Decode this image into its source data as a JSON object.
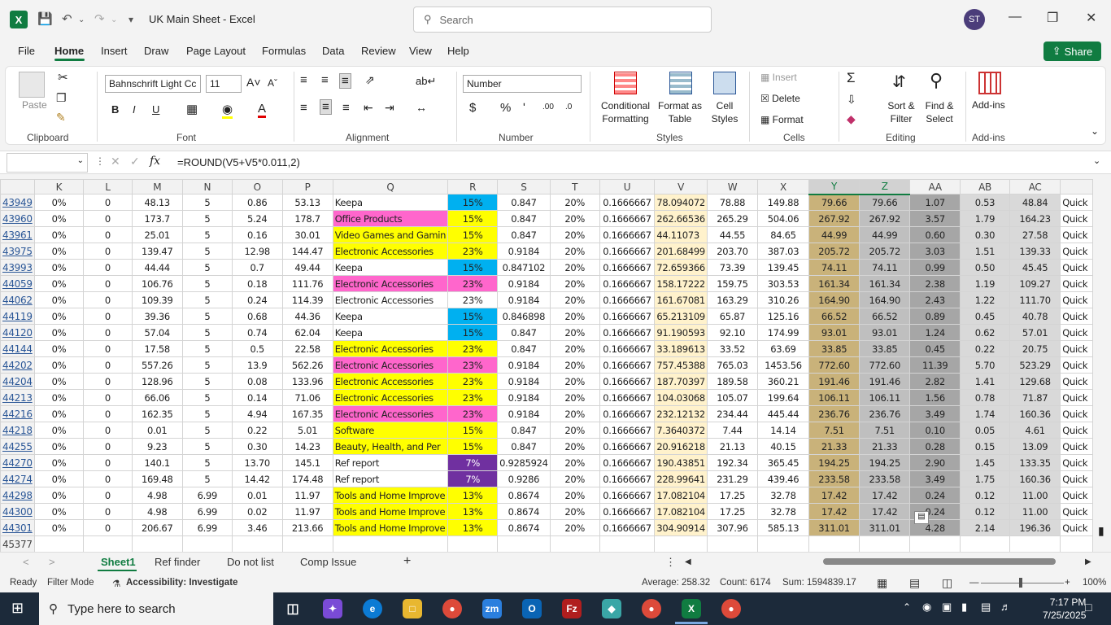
{
  "window": {
    "title": "UK Main Sheet  -  Excel",
    "user_initials": "ST"
  },
  "search": {
    "placeholder": "Search"
  },
  "menu": [
    "File",
    "Home",
    "Insert",
    "Draw",
    "Page Layout",
    "Formulas",
    "Data",
    "Review",
    "View",
    "Help"
  ],
  "share_label": "Share",
  "ribbon": {
    "clipboard": {
      "label": "Clipboard",
      "paste": "Paste"
    },
    "font": {
      "label": "Font",
      "name": "Bahnschrift Light Cc",
      "size": "11",
      "bold": "B",
      "italic": "I",
      "underline": "U"
    },
    "alignment": {
      "label": "Alignment"
    },
    "number": {
      "label": "Number",
      "format": "Number"
    },
    "styles": {
      "label": "Styles",
      "conditional": "Conditional Formatting",
      "format_table": "Format as Table",
      "cell_styles": "Cell Styles"
    },
    "cells": {
      "label": "Cells",
      "insert": "Insert",
      "delete": "Delete",
      "format": "Format"
    },
    "editing": {
      "label": "Editing",
      "sort": "Sort & Filter",
      "find": "Find & Select"
    },
    "addins": {
      "label": "Add-ins",
      "addins": "Add-ins"
    }
  },
  "formula_bar": {
    "formula": "=ROUND(V5+V5*0.011,2)",
    "fx": "fx"
  },
  "columns": [
    "K",
    "L",
    "M",
    "N",
    "O",
    "P",
    "Q",
    "R",
    "S",
    "T",
    "U",
    "V",
    "W",
    "X",
    "Y",
    "Z",
    "AA",
    "AB",
    "AC",
    ""
  ],
  "selected_columns": [
    "Y",
    "Z"
  ],
  "colors": {
    "pink": "#ff66cc",
    "yellow": "#ffff00",
    "cyan": "#00b0f0",
    "purple": "#7030a0",
    "tan": "#fff2cc",
    "yz": "#c9b27a",
    "yz2": "#bfbfbf",
    "aa": "#a6a6a6",
    "excel_green": "#107c41"
  },
  "rows": [
    {
      "r": "43949",
      "k": "0%",
      "l": "0",
      "m": "48.13",
      "n": "5",
      "o": "0.86",
      "p": "53.13",
      "q": "Keepa",
      "qc": "",
      "rv": "15%",
      "rc": "cyan",
      "s": "0.847",
      "t": "20%",
      "u": "0.1666667",
      "v": "78.094072",
      "w": "78.88",
      "x": "149.88",
      "y": "79.66",
      "z": "79.66",
      "aa": "1.07",
      "ab": "0.53",
      "ac": "48.84",
      "ad": "Quick"
    },
    {
      "r": "43960",
      "k": "0%",
      "l": "0",
      "m": "173.7",
      "n": "5",
      "o": "5.24",
      "p": "178.7",
      "q": "Office Products",
      "qc": "pink",
      "rv": "15%",
      "rc": "yellow",
      "s": "0.847",
      "t": "20%",
      "u": "0.1666667",
      "v": "262.66536",
      "w": "265.29",
      "x": "504.06",
      "y": "267.92",
      "z": "267.92",
      "aa": "3.57",
      "ab": "1.79",
      "ac": "164.23",
      "ad": "Quick"
    },
    {
      "r": "43961",
      "k": "0%",
      "l": "0",
      "m": "25.01",
      "n": "5",
      "o": "0.16",
      "p": "30.01",
      "q": "Video Games and Gamin",
      "qc": "yellow",
      "rv": "15%",
      "rc": "yellow",
      "s": "0.847",
      "t": "20%",
      "u": "0.1666667",
      "v": "44.11073",
      "w": "44.55",
      "x": "84.65",
      "y": "44.99",
      "z": "44.99",
      "aa": "0.60",
      "ab": "0.30",
      "ac": "27.58",
      "ad": "Quick"
    },
    {
      "r": "43975",
      "k": "0%",
      "l": "0",
      "m": "139.47",
      "n": "5",
      "o": "12.98",
      "p": "144.47",
      "q": "Electronic Accessories",
      "qc": "yellow",
      "rv": "23%",
      "rc": "yellow",
      "s": "0.9184",
      "t": "20%",
      "u": "0.1666667",
      "v": "201.68499",
      "w": "203.70",
      "x": "387.03",
      "y": "205.72",
      "z": "205.72",
      "aa": "3.03",
      "ab": "1.51",
      "ac": "139.33",
      "ad": "Quick"
    },
    {
      "r": "43993",
      "k": "0%",
      "l": "0",
      "m": "44.44",
      "n": "5",
      "o": "0.7",
      "p": "49.44",
      "q": "Keepa",
      "qc": "",
      "rv": "15%",
      "rc": "cyan",
      "s": "0.847102",
      "t": "20%",
      "u": "0.1666667",
      "v": "72.659366",
      "w": "73.39",
      "x": "139.45",
      "y": "74.11",
      "z": "74.11",
      "aa": "0.99",
      "ab": "0.50",
      "ac": "45.45",
      "ad": "Quick"
    },
    {
      "r": "44059",
      "k": "0%",
      "l": "0",
      "m": "106.76",
      "n": "5",
      "o": "0.18",
      "p": "111.76",
      "q": "Electronic Accessories",
      "qc": "pink",
      "rv": "23%",
      "rc": "pink",
      "s": "0.9184",
      "t": "20%",
      "u": "0.1666667",
      "v": "158.17222",
      "w": "159.75",
      "x": "303.53",
      "y": "161.34",
      "z": "161.34",
      "aa": "2.38",
      "ab": "1.19",
      "ac": "109.27",
      "ad": "Quick"
    },
    {
      "r": "44062",
      "k": "0%",
      "l": "0",
      "m": "109.39",
      "n": "5",
      "o": "0.24",
      "p": "114.39",
      "q": "Electronic Accessories",
      "qc": "",
      "rv": "23%",
      "rc": "",
      "s": "0.9184",
      "t": "20%",
      "u": "0.1666667",
      "v": "161.67081",
      "w": "163.29",
      "x": "310.26",
      "y": "164.90",
      "z": "164.90",
      "aa": "2.43",
      "ab": "1.22",
      "ac": "111.70",
      "ad": "Quick"
    },
    {
      "r": "44119",
      "k": "0%",
      "l": "0",
      "m": "39.36",
      "n": "5",
      "o": "0.68",
      "p": "44.36",
      "q": "Keepa",
      "qc": "",
      "rv": "15%",
      "rc": "cyan",
      "s": "0.846898",
      "t": "20%",
      "u": "0.1666667",
      "v": "65.213109",
      "w": "65.87",
      "x": "125.16",
      "y": "66.52",
      "z": "66.52",
      "aa": "0.89",
      "ab": "0.45",
      "ac": "40.78",
      "ad": "Quick"
    },
    {
      "r": "44120",
      "k": "0%",
      "l": "0",
      "m": "57.04",
      "n": "5",
      "o": "0.74",
      "p": "62.04",
      "q": "Keepa",
      "qc": "",
      "rv": "15%",
      "rc": "cyan",
      "s": "0.847",
      "t": "20%",
      "u": "0.1666667",
      "v": "91.190593",
      "w": "92.10",
      "x": "174.99",
      "y": "93.01",
      "z": "93.01",
      "aa": "1.24",
      "ab": "0.62",
      "ac": "57.01",
      "ad": "Quick"
    },
    {
      "r": "44144",
      "k": "0%",
      "l": "0",
      "m": "17.58",
      "n": "5",
      "o": "0.5",
      "p": "22.58",
      "q": "Electronic Accessories",
      "qc": "yellow",
      "rv": "23%",
      "rc": "yellow",
      "s": "0.847",
      "t": "20%",
      "u": "0.1666667",
      "v": "33.189613",
      "w": "33.52",
      "x": "63.69",
      "y": "33.85",
      "z": "33.85",
      "aa": "0.45",
      "ab": "0.22",
      "ac": "20.75",
      "ad": "Quick"
    },
    {
      "r": "44202",
      "k": "0%",
      "l": "0",
      "m": "557.26",
      "n": "5",
      "o": "13.9",
      "p": "562.26",
      "q": "Electronic Accessories",
      "qc": "pink",
      "rv": "23%",
      "rc": "pink",
      "s": "0.9184",
      "t": "20%",
      "u": "0.1666667",
      "v": "757.45388",
      "w": "765.03",
      "x": "1453.56",
      "y": "772.60",
      "z": "772.60",
      "aa": "11.39",
      "ab": "5.70",
      "ac": "523.29",
      "ad": "Quick"
    },
    {
      "r": "44204",
      "k": "0%",
      "l": "0",
      "m": "128.96",
      "n": "5",
      "o": "0.08",
      "p": "133.96",
      "q": "Electronic Accessories",
      "qc": "yellow",
      "rv": "23%",
      "rc": "yellow",
      "s": "0.9184",
      "t": "20%",
      "u": "0.1666667",
      "v": "187.70397",
      "w": "189.58",
      "x": "360.21",
      "y": "191.46",
      "z": "191.46",
      "aa": "2.82",
      "ab": "1.41",
      "ac": "129.68",
      "ad": "Quick"
    },
    {
      "r": "44213",
      "k": "0%",
      "l": "0",
      "m": "66.06",
      "n": "5",
      "o": "0.14",
      "p": "71.06",
      "q": "Electronic Accessories",
      "qc": "yellow",
      "rv": "23%",
      "rc": "yellow",
      "s": "0.9184",
      "t": "20%",
      "u": "0.1666667",
      "v": "104.03068",
      "w": "105.07",
      "x": "199.64",
      "y": "106.11",
      "z": "106.11",
      "aa": "1.56",
      "ab": "0.78",
      "ac": "71.87",
      "ad": "Quick"
    },
    {
      "r": "44216",
      "k": "0%",
      "l": "0",
      "m": "162.35",
      "n": "5",
      "o": "4.94",
      "p": "167.35",
      "q": "Electronic Accessories",
      "qc": "pink",
      "rv": "23%",
      "rc": "pink",
      "s": "0.9184",
      "t": "20%",
      "u": "0.1666667",
      "v": "232.12132",
      "w": "234.44",
      "x": "445.44",
      "y": "236.76",
      "z": "236.76",
      "aa": "3.49",
      "ab": "1.74",
      "ac": "160.36",
      "ad": "Quick"
    },
    {
      "r": "44218",
      "k": "0%",
      "l": "0",
      "m": "0.01",
      "n": "5",
      "o": "0.22",
      "p": "5.01",
      "q": "Software",
      "qc": "yellow",
      "rv": "15%",
      "rc": "yellow",
      "s": "0.847",
      "t": "20%",
      "u": "0.1666667",
      "v": "7.3640372",
      "w": "7.44",
      "x": "14.14",
      "y": "7.51",
      "z": "7.51",
      "aa": "0.10",
      "ab": "0.05",
      "ac": "4.61",
      "ad": "Quick"
    },
    {
      "r": "44255",
      "k": "0%",
      "l": "0",
      "m": "9.23",
      "n": "5",
      "o": "0.30",
      "p": "14.23",
      "q": "Beauty, Health, and Per",
      "qc": "yellow",
      "rv": "15%",
      "rc": "yellow",
      "s": "0.847",
      "t": "20%",
      "u": "0.1666667",
      "v": "20.916218",
      "w": "21.13",
      "x": "40.15",
      "y": "21.33",
      "z": "21.33",
      "aa": "0.28",
      "ab": "0.15",
      "ac": "13.09",
      "ad": "Quick"
    },
    {
      "r": "44270",
      "k": "0%",
      "l": "0",
      "m": "140.1",
      "n": "5",
      "o": "13.70",
      "p": "145.1",
      "q": "Ref report",
      "qc": "",
      "rv": "7%",
      "rc": "purple",
      "s": "0.9285924",
      "t": "20%",
      "u": "0.1666667",
      "v": "190.43851",
      "w": "192.34",
      "x": "365.45",
      "y": "194.25",
      "z": "194.25",
      "aa": "2.90",
      "ab": "1.45",
      "ac": "133.35",
      "ad": "Quick"
    },
    {
      "r": "44274",
      "k": "0%",
      "l": "0",
      "m": "169.48",
      "n": "5",
      "o": "14.42",
      "p": "174.48",
      "q": "Ref report",
      "qc": "",
      "rv": "7%",
      "rc": "purple",
      "s": "0.9286",
      "t": "20%",
      "u": "0.1666667",
      "v": "228.99641",
      "w": "231.29",
      "x": "439.46",
      "y": "233.58",
      "z": "233.58",
      "aa": "3.49",
      "ab": "1.75",
      "ac": "160.36",
      "ad": "Quick"
    },
    {
      "r": "44298",
      "k": "0%",
      "l": "0",
      "m": "4.98",
      "n": "6.99",
      "o": "0.01",
      "p": "11.97",
      "q": "Tools and Home Improve",
      "qc": "yellow",
      "rv": "13%",
      "rc": "yellow",
      "s": "0.8674",
      "t": "20%",
      "u": "0.1666667",
      "v": "17.082104",
      "w": "17.25",
      "x": "32.78",
      "y": "17.42",
      "z": "17.42",
      "aa": "0.24",
      "ab": "0.12",
      "ac": "11.00",
      "ad": "Quick"
    },
    {
      "r": "44300",
      "k": "0%",
      "l": "0",
      "m": "4.98",
      "n": "6.99",
      "o": "0.02",
      "p": "11.97",
      "q": "Tools and Home Improve",
      "qc": "yellow",
      "rv": "13%",
      "rc": "yellow",
      "s": "0.8674",
      "t": "20%",
      "u": "0.1666667",
      "v": "17.082104",
      "w": "17.25",
      "x": "32.78",
      "y": "17.42",
      "z": "17.42",
      "aa": "0.24",
      "ab": "0.12",
      "ac": "11.00",
      "ad": "Quick"
    },
    {
      "r": "44301",
      "k": "0%",
      "l": "0",
      "m": "206.67",
      "n": "6.99",
      "o": "3.46",
      "p": "213.66",
      "q": "Tools and Home Improve",
      "qc": "yellow",
      "rv": "13%",
      "rc": "yellow",
      "s": "0.8674",
      "t": "20%",
      "u": "0.1666667",
      "v": "304.90914",
      "w": "307.96",
      "x": "585.13",
      "y": "311.01",
      "z": "311.01",
      "aa": "4.28",
      "ab": "2.14",
      "ac": "196.36",
      "ad": "Quick"
    }
  ],
  "last_row_header": "45377",
  "sheets": [
    "Sheet1",
    "Ref finder",
    "Do not list",
    "Comp Issue"
  ],
  "active_sheet": "Sheet1",
  "status": {
    "ready": "Ready",
    "filter": "Filter Mode",
    "accessibility": "Accessibility: Investigate",
    "average": "Average: 258.32",
    "count": "Count: 6174",
    "sum": "Sum: 1594839.17",
    "zoom": "100%"
  },
  "taskbar": {
    "search_placeholder": "Type here to search",
    "time": "7:17 PM",
    "date": "7/25/2025"
  }
}
